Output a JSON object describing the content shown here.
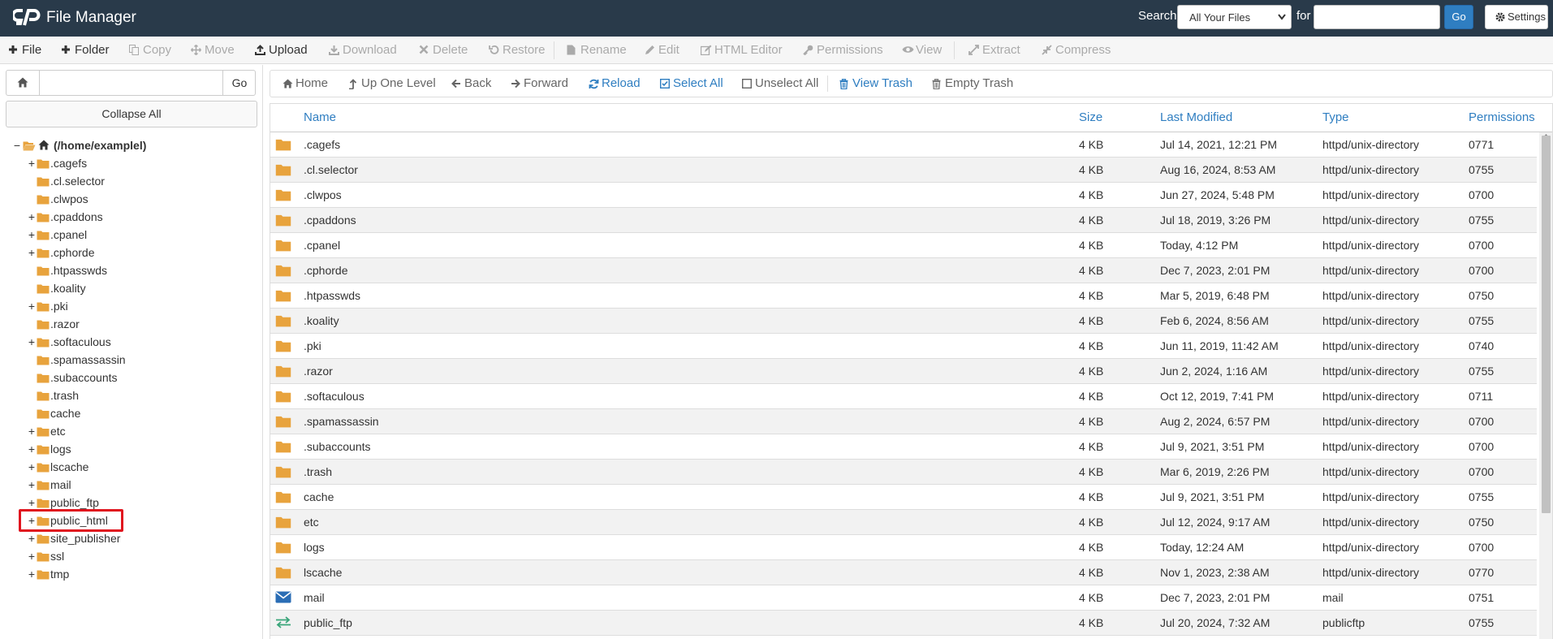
{
  "header": {
    "title": "File Manager",
    "search_label": "Search",
    "scope_value": "All Your Files",
    "for_label": "for",
    "search_value": "",
    "go_label": "Go",
    "settings_label": "Settings",
    "bg_color": "#293a4a"
  },
  "toolbar": {
    "items": [
      {
        "label": "File",
        "icon": "plus-icon",
        "enabled": true
      },
      {
        "label": "Folder",
        "icon": "plus-icon",
        "enabled": true
      },
      {
        "label": "Copy",
        "icon": "copy-icon",
        "enabled": false
      },
      {
        "label": "Move",
        "icon": "move-icon",
        "enabled": false
      },
      {
        "label": "Upload",
        "icon": "upload-icon",
        "enabled": true
      },
      {
        "label": "Download",
        "icon": "download-icon",
        "enabled": false
      },
      {
        "label": "Delete",
        "icon": "close-icon",
        "enabled": false
      },
      {
        "label": "Restore",
        "icon": "restore-icon",
        "enabled": false
      },
      {
        "label": "Rename",
        "icon": "file-icon",
        "enabled": false
      },
      {
        "label": "Edit",
        "icon": "pencil-icon",
        "enabled": false
      },
      {
        "label": "HTML Editor",
        "icon": "edit-icon",
        "enabled": false
      },
      {
        "label": "Permissions",
        "icon": "key-icon",
        "enabled": false
      },
      {
        "label": "View",
        "icon": "eye-icon",
        "enabled": false
      },
      {
        "label": "Extract",
        "icon": "expand-icon",
        "enabled": false
      },
      {
        "label": "Compress",
        "icon": "compress-icon",
        "enabled": false
      }
    ]
  },
  "left": {
    "path_value": "",
    "go_label": "Go",
    "collapse_label": "Collapse All",
    "tree": [
      {
        "label": "(/home/examplel)",
        "expander": "−",
        "root": true,
        "icon": "folder-open-icon"
      },
      {
        "label": ".cagefs",
        "expander": "+"
      },
      {
        "label": ".cl.selector",
        "expander": ""
      },
      {
        "label": ".clwpos",
        "expander": ""
      },
      {
        "label": ".cpaddons",
        "expander": "+"
      },
      {
        "label": ".cpanel",
        "expander": "+"
      },
      {
        "label": ".cphorde",
        "expander": "+"
      },
      {
        "label": ".htpasswds",
        "expander": ""
      },
      {
        "label": ".koality",
        "expander": ""
      },
      {
        "label": ".pki",
        "expander": "+"
      },
      {
        "label": ".razor",
        "expander": ""
      },
      {
        "label": ".softaculous",
        "expander": "+"
      },
      {
        "label": ".spamassassin",
        "expander": ""
      },
      {
        "label": ".subaccounts",
        "expander": ""
      },
      {
        "label": ".trash",
        "expander": ""
      },
      {
        "label": "cache",
        "expander": ""
      },
      {
        "label": "etc",
        "expander": "+"
      },
      {
        "label": "logs",
        "expander": "+"
      },
      {
        "label": "lscache",
        "expander": "+"
      },
      {
        "label": "mail",
        "expander": "+"
      },
      {
        "label": "public_ftp",
        "expander": "+"
      },
      {
        "label": "public_html",
        "expander": "+",
        "highlighted": true
      },
      {
        "label": "site_publisher",
        "expander": "+"
      },
      {
        "label": "ssl",
        "expander": "+"
      },
      {
        "label": "tmp",
        "expander": "+"
      }
    ]
  },
  "nav": {
    "items": [
      {
        "label": "Home",
        "icon": "home-icon",
        "link": false
      },
      {
        "label": "Up One Level",
        "icon": "level-up-icon",
        "link": false
      },
      {
        "label": "Back",
        "icon": "arrow-left-icon",
        "link": false
      },
      {
        "label": "Forward",
        "icon": "arrow-right-icon",
        "link": false
      },
      {
        "label": "Reload",
        "icon": "reload-icon",
        "link": true
      },
      {
        "label": "Select All",
        "icon": "checkbox-checked-icon",
        "link": true
      },
      {
        "label": "Unselect All",
        "icon": "checkbox-icon",
        "link": false
      },
      {
        "label": "View Trash",
        "icon": "trash-icon",
        "link": true
      },
      {
        "label": "Empty Trash",
        "icon": "trash-icon",
        "link": false
      }
    ]
  },
  "table": {
    "columns": [
      "Name",
      "Size",
      "Last Modified",
      "Type",
      "Permissions"
    ],
    "rows": [
      {
        "name": ".cagefs",
        "size": "4 KB",
        "modified": "Jul 14, 2021, 12:21 PM",
        "type": "httpd/unix-directory",
        "perms": "0771",
        "icon": "folder-icon"
      },
      {
        "name": ".cl.selector",
        "size": "4 KB",
        "modified": "Aug 16, 2024, 8:53 AM",
        "type": "httpd/unix-directory",
        "perms": "0755",
        "icon": "folder-icon"
      },
      {
        "name": ".clwpos",
        "size": "4 KB",
        "modified": "Jun 27, 2024, 5:48 PM",
        "type": "httpd/unix-directory",
        "perms": "0700",
        "icon": "folder-icon"
      },
      {
        "name": ".cpaddons",
        "size": "4 KB",
        "modified": "Jul 18, 2019, 3:26 PM",
        "type": "httpd/unix-directory",
        "perms": "0755",
        "icon": "folder-icon"
      },
      {
        "name": ".cpanel",
        "size": "4 KB",
        "modified": "Today, 4:12 PM",
        "type": "httpd/unix-directory",
        "perms": "0700",
        "icon": "folder-icon"
      },
      {
        "name": ".cphorde",
        "size": "4 KB",
        "modified": "Dec 7, 2023, 2:01 PM",
        "type": "httpd/unix-directory",
        "perms": "0700",
        "icon": "folder-icon"
      },
      {
        "name": ".htpasswds",
        "size": "4 KB",
        "modified": "Mar 5, 2019, 6:48 PM",
        "type": "httpd/unix-directory",
        "perms": "0750",
        "icon": "folder-icon"
      },
      {
        "name": ".koality",
        "size": "4 KB",
        "modified": "Feb 6, 2024, 8:56 AM",
        "type": "httpd/unix-directory",
        "perms": "0755",
        "icon": "folder-icon"
      },
      {
        "name": ".pki",
        "size": "4 KB",
        "modified": "Jun 11, 2019, 11:42 AM",
        "type": "httpd/unix-directory",
        "perms": "0740",
        "icon": "folder-icon"
      },
      {
        "name": ".razor",
        "size": "4 KB",
        "modified": "Jun 2, 2024, 1:16 AM",
        "type": "httpd/unix-directory",
        "perms": "0755",
        "icon": "folder-icon"
      },
      {
        "name": ".softaculous",
        "size": "4 KB",
        "modified": "Oct 12, 2019, 7:41 PM",
        "type": "httpd/unix-directory",
        "perms": "0711",
        "icon": "folder-icon"
      },
      {
        "name": ".spamassassin",
        "size": "4 KB",
        "modified": "Aug 2, 2024, 6:57 PM",
        "type": "httpd/unix-directory",
        "perms": "0700",
        "icon": "folder-icon"
      },
      {
        "name": ".subaccounts",
        "size": "4 KB",
        "modified": "Jul 9, 2021, 3:51 PM",
        "type": "httpd/unix-directory",
        "perms": "0700",
        "icon": "folder-icon"
      },
      {
        "name": ".trash",
        "size": "4 KB",
        "modified": "Mar 6, 2019, 2:26 PM",
        "type": "httpd/unix-directory",
        "perms": "0700",
        "icon": "folder-icon"
      },
      {
        "name": "cache",
        "size": "4 KB",
        "modified": "Jul 9, 2021, 3:51 PM",
        "type": "httpd/unix-directory",
        "perms": "0755",
        "icon": "folder-icon"
      },
      {
        "name": "etc",
        "size": "4 KB",
        "modified": "Jul 12, 2024, 9:17 AM",
        "type": "httpd/unix-directory",
        "perms": "0750",
        "icon": "folder-icon"
      },
      {
        "name": "logs",
        "size": "4 KB",
        "modified": "Today, 12:24 AM",
        "type": "httpd/unix-directory",
        "perms": "0700",
        "icon": "folder-icon"
      },
      {
        "name": "lscache",
        "size": "4 KB",
        "modified": "Nov 1, 2023, 2:38 AM",
        "type": "httpd/unix-directory",
        "perms": "0770",
        "icon": "folder-icon"
      },
      {
        "name": "mail",
        "size": "4 KB",
        "modified": "Dec 7, 2023, 2:01 PM",
        "type": "mail",
        "perms": "0751",
        "icon": "mail-icon"
      },
      {
        "name": "public_ftp",
        "size": "4 KB",
        "modified": "Jul 20, 2024, 7:32 AM",
        "type": "publicftp",
        "perms": "0755",
        "icon": "exchange-icon"
      }
    ]
  },
  "colors": {
    "folder": "#e8a33d",
    "link": "#2f7ec1",
    "highlight": "#e0141e",
    "mail": "#2a6db5",
    "ftp": "#3aa57a"
  }
}
